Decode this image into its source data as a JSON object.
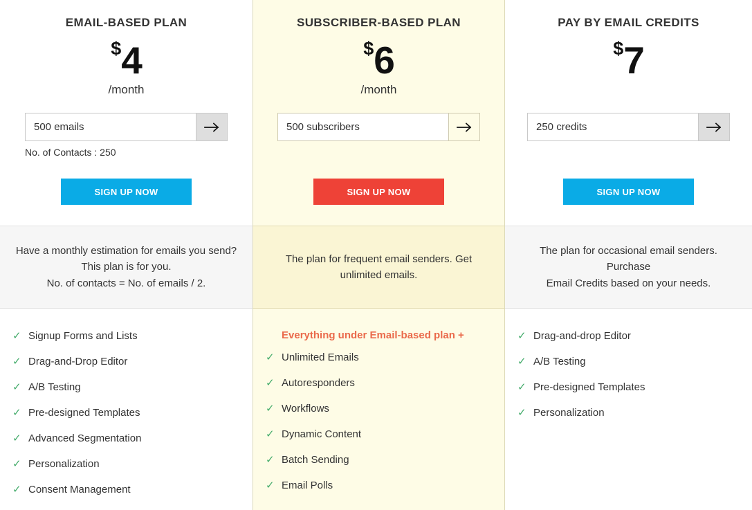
{
  "colors": {
    "cta_blue": "#0aabe6",
    "cta_red": "#ee4237",
    "featured_bg": "#fefce6",
    "featured_band_bg": "#faf5d4",
    "band_bg": "#f6f6f6",
    "check_green": "#43ab6a",
    "heading_orange": "#ea6a4b"
  },
  "plans": [
    {
      "id": "email-based",
      "title": "EMAIL-BASED PLAN",
      "currency": "$",
      "amount": "4",
      "period": "/month",
      "input_value": "500 emails",
      "input_placeholder": "500 emails",
      "submit_icon": "arrow-right-icon",
      "note": "No. of Contacts : 250",
      "cta_label": "SIGN UP NOW",
      "cta_color": "#0aabe6",
      "description": "Have a monthly estimation for emails you send? This plan is for you. No. of contacts = No. of emails / 2.",
      "description_lines": [
        "Have a monthly estimation for emails you send?",
        "This plan is for you.",
        "No. of contacts = No. of emails / 2."
      ],
      "features_heading": "",
      "features": [
        "Signup Forms and Lists",
        "Drag-and-Drop Editor",
        "A/B Testing",
        "Pre-designed Templates",
        "Advanced Segmentation",
        "Personalization",
        "Consent Management"
      ]
    },
    {
      "id": "subscriber-based",
      "title": "SUBSCRIBER-BASED PLAN",
      "currency": "$",
      "amount": "6",
      "period": "/month",
      "input_value": "500 subscribers",
      "input_placeholder": "500 subscribers",
      "submit_icon": "arrow-right-icon",
      "note": "",
      "cta_label": "SIGN UP NOW",
      "cta_color": "#ee4237",
      "description": "The plan for frequent email senders. Get unlimited emails.",
      "description_lines": [
        "The plan for frequent email senders. Get",
        "unlimited emails."
      ],
      "features_heading": "Everything under Email-based plan +",
      "features": [
        "Unlimited Emails",
        "Autoresponders",
        "Workflows",
        "Dynamic Content",
        "Batch Sending",
        "Email Polls"
      ]
    },
    {
      "id": "email-credits",
      "title": "PAY BY EMAIL CREDITS",
      "currency": "$",
      "amount": "7",
      "period": "",
      "input_value": "250 credits",
      "input_placeholder": "250 credits",
      "submit_icon": "arrow-right-icon",
      "note": "",
      "cta_label": "SIGN UP NOW",
      "cta_color": "#0aabe6",
      "description": "The plan for occasional email senders. Purchase Email Credits based on your needs.",
      "description_lines": [
        "The plan for occasional email senders. Purchase",
        "Email Credits based on your needs."
      ],
      "features_heading": "",
      "features": [
        "Drag-and-drop Editor",
        "A/B Testing",
        "Pre-designed Templates",
        "Personalization"
      ]
    }
  ]
}
